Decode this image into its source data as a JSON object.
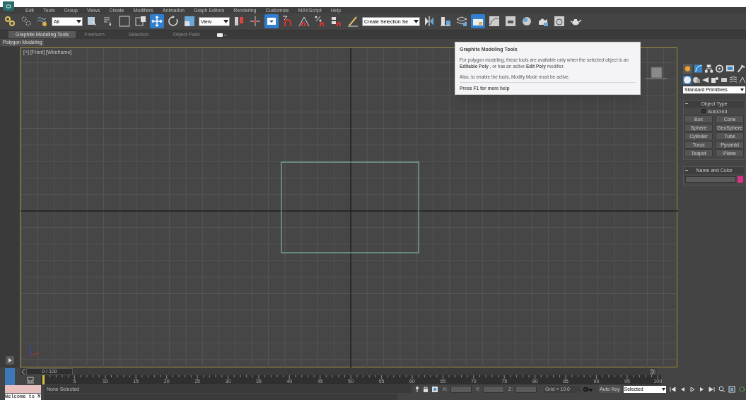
{
  "menu": [
    "Edit",
    "Tools",
    "Group",
    "Views",
    "Create",
    "Modifiers",
    "Animation",
    "Graph Editors",
    "Rendering",
    "Customize",
    "MAXScript",
    "Help"
  ],
  "toolbar": [
    {
      "kind": "button",
      "selected": false
    },
    {
      "kind": "button",
      "selected": false
    },
    {
      "kind": "button",
      "selected": false
    },
    {
      "kind": "dropdown",
      "value": "All"
    },
    {
      "kind": "button",
      "selected": false
    },
    {
      "kind": "button",
      "selected": false
    },
    {
      "kind": "button",
      "selected": false
    },
    {
      "kind": "button",
      "selected": false
    },
    {
      "kind": "button",
      "selected": true
    },
    {
      "kind": "button",
      "selected": false
    },
    {
      "kind": "button",
      "selected": false
    },
    {
      "kind": "dropdown",
      "value": "View"
    },
    {
      "kind": "button",
      "selected": false
    },
    {
      "kind": "button",
      "selected": false
    },
    {
      "kind": "button",
      "selected": true
    },
    {
      "kind": "button",
      "selected": false
    },
    {
      "kind": "button",
      "selected": false
    },
    {
      "kind": "button",
      "selected": false
    },
    {
      "kind": "button",
      "selected": false
    },
    {
      "kind": "button",
      "selected": false
    },
    {
      "kind": "dropdown",
      "value": "Create Selection Se"
    },
    {
      "kind": "button",
      "selected": false
    },
    {
      "kind": "button",
      "selected": false
    },
    {
      "kind": "button",
      "selected": false
    },
    {
      "kind": "button",
      "selected": true
    },
    {
      "kind": "button",
      "selected": false
    },
    {
      "kind": "button",
      "selected": false
    },
    {
      "kind": "button",
      "selected": false
    },
    {
      "kind": "button",
      "selected": false
    },
    {
      "kind": "button",
      "selected": false
    },
    {
      "kind": "button",
      "selected": false
    }
  ],
  "ribbon_tabs": [
    {
      "label": "Graphite Modeling Tools",
      "selected": true
    },
    {
      "label": "Freeform",
      "selected": false
    },
    {
      "label": "Selection",
      "selected": false
    },
    {
      "label": "Object Paint",
      "selected": false
    }
  ],
  "ribbon_panel": "Polygon Modeling",
  "viewport": {
    "label": "[+] [Front] [Wireframe]"
  },
  "tooltip": {
    "title": "Graphite Modeling Tools",
    "body": "For polygon modeling, these tools are available only when the selected object is an **Editable Poly** , or has an active **Edit Poly** modifier.",
    "note": "Also, to enable the tools, Modify Mode must be active.",
    "footer": "Press F1 for more help"
  },
  "command_panel": {
    "tabs": [
      {
        "selected": true
      },
      {
        "selected": false
      },
      {
        "selected": false
      },
      {
        "selected": false
      },
      {
        "selected": false
      },
      {
        "selected": false
      }
    ],
    "categories": [
      {
        "selected": true
      },
      {
        "selected": false
      },
      {
        "selected": false
      },
      {
        "selected": false
      },
      {
        "selected": false
      },
      {
        "selected": false
      },
      {
        "selected": false
      }
    ],
    "dropdown": "Standard Primitives",
    "object_type": {
      "title": "Object Type",
      "autogrid": {
        "label": "AutoGrid",
        "checked": false
      },
      "buttons": [
        "Box",
        "Cone",
        "Sphere",
        "GeoSphere",
        "Cylinder",
        "Tube",
        "Torus",
        "Pyramid",
        "Teapot",
        "Plane"
      ]
    },
    "name_and_color": {
      "title": "Name and Color",
      "color": "#e0308a"
    }
  },
  "time_slider": {
    "label": "0 / 100",
    "level": 0
  },
  "track_labels": [
    "5",
    "10",
    "15",
    "20",
    "25",
    "30",
    "35",
    "40",
    "45",
    "50",
    "55",
    "60",
    "65",
    "70",
    "75",
    "80",
    "85",
    "90",
    "95",
    "100"
  ],
  "status": {
    "selection": "None Selected",
    "x_label": "X:",
    "y_label": "Y:",
    "z_label": "Z:",
    "grid": "Grid = 10.0",
    "auto_key": "Auto Key",
    "key_mode": "Selected"
  },
  "listener": "Welcome to M"
}
